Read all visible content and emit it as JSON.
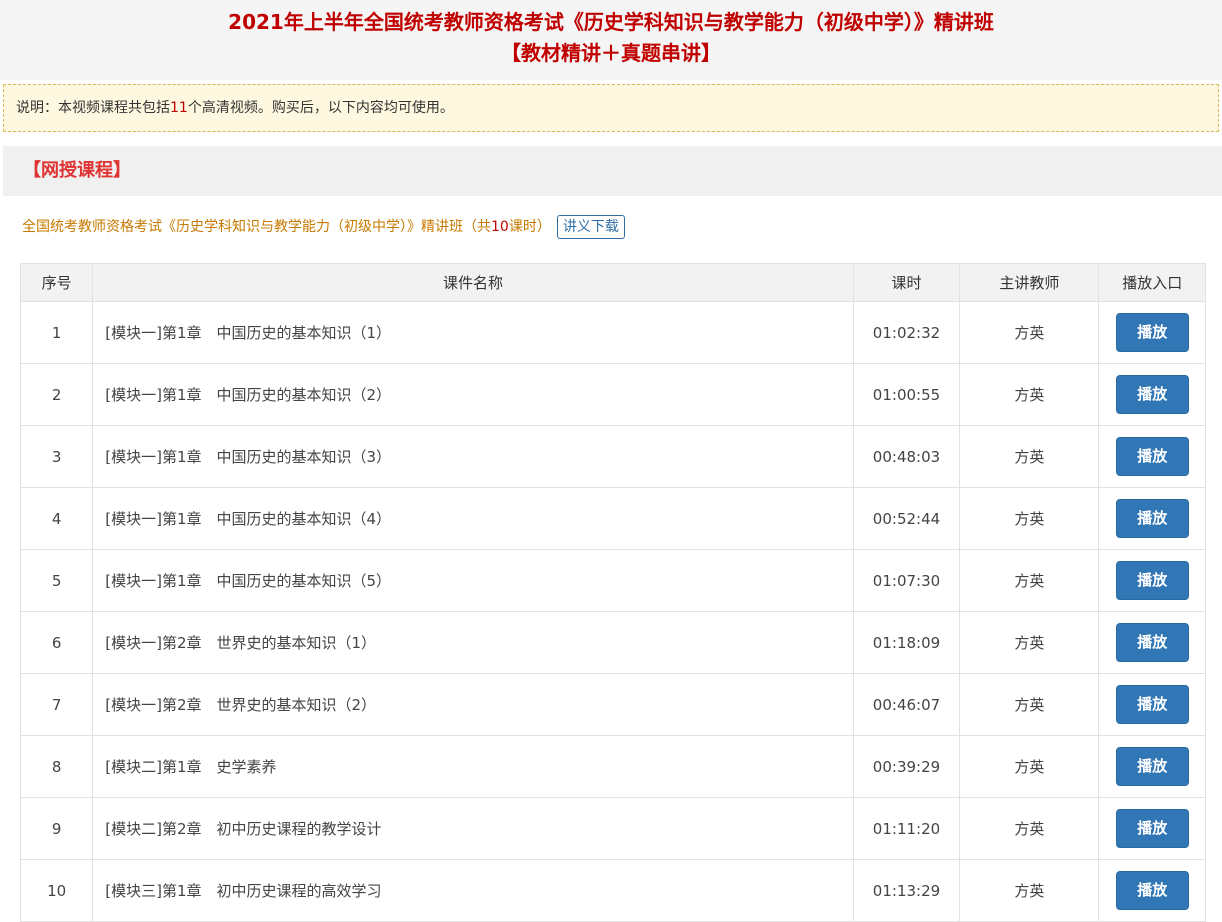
{
  "header": {
    "title_line1": "2021年上半年全国统考教师资格考试《历史学科知识与教学能力（初级中学）》精讲班",
    "title_line2": "【教材精讲＋真题串讲】"
  },
  "notice": {
    "prefix": "说明：本视频课程共包括",
    "count": "11",
    "suffix": "个高清视频。购买后，以下内容均可使用。"
  },
  "section": {
    "title": "【网授课程】"
  },
  "course": {
    "name": "全国统考教师资格考试《历史学科知识与教学能力（初级中学）》精讲班",
    "hours_prefix": "（共",
    "hours_num": "10",
    "hours_suffix": "课时）",
    "download_label": "讲义下载"
  },
  "table": {
    "headers": [
      "序号",
      "课件名称",
      "课时",
      "主讲教师",
      "播放入口"
    ],
    "rows": [
      {
        "no": "1",
        "name": "[模块一]第1章　中国历史的基本知识（1）",
        "duration": "01:02:32",
        "teacher": "方英",
        "play": "播放"
      },
      {
        "no": "2",
        "name": "[模块一]第1章　中国历史的基本知识（2）",
        "duration": "01:00:55",
        "teacher": "方英",
        "play": "播放"
      },
      {
        "no": "3",
        "name": "[模块一]第1章　中国历史的基本知识（3）",
        "duration": "00:48:03",
        "teacher": "方英",
        "play": "播放"
      },
      {
        "no": "4",
        "name": "[模块一]第1章　中国历史的基本知识（4）",
        "duration": "00:52:44",
        "teacher": "方英",
        "play": "播放"
      },
      {
        "no": "5",
        "name": "[模块一]第1章　中国历史的基本知识（5）",
        "duration": "01:07:30",
        "teacher": "方英",
        "play": "播放"
      },
      {
        "no": "6",
        "name": "[模块一]第2章　世界史的基本知识（1）",
        "duration": "01:18:09",
        "teacher": "方英",
        "play": "播放"
      },
      {
        "no": "7",
        "name": "[模块一]第2章　世界史的基本知识（2）",
        "duration": "00:46:07",
        "teacher": "方英",
        "play": "播放"
      },
      {
        "no": "8",
        "name": "[模块二]第1章　史学素养",
        "duration": "00:39:29",
        "teacher": "方英",
        "play": "播放"
      },
      {
        "no": "9",
        "name": "[模块二]第2章　初中历史课程的教学设计",
        "duration": "01:11:20",
        "teacher": "方英",
        "play": "播放"
      },
      {
        "no": "10",
        "name": "[模块三]第1章　初中历史课程的高效学习",
        "duration": "01:13:29",
        "teacher": "方英",
        "play": "播放"
      }
    ]
  }
}
